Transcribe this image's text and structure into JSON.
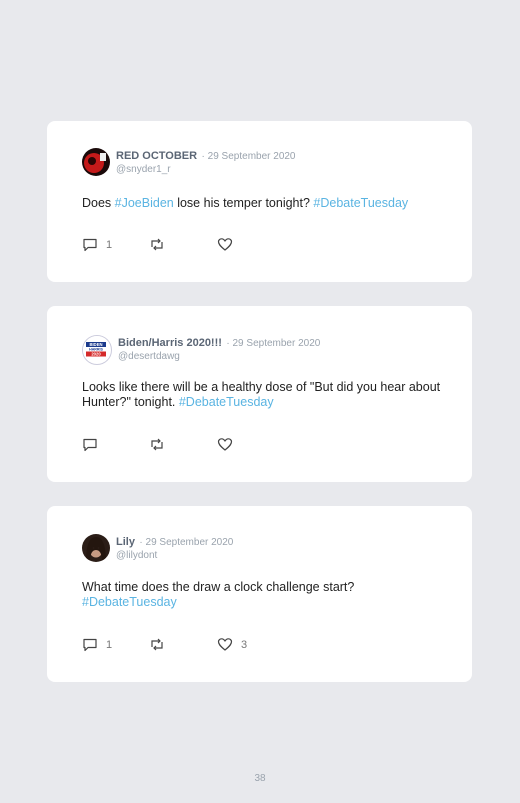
{
  "tweets": [
    {
      "name": "RED OCTOBER",
      "date": "· 29 September 2020",
      "handle": "@snyder1_r",
      "text_before": "Does ",
      "tag1": "#JoeBiden",
      "text_middle": " lose his temper tonight? ",
      "tag2": "#DebateTuesday",
      "replies": "1",
      "retweets": "",
      "likes": ""
    },
    {
      "name": "Biden/Harris 2020!!!",
      "date": "· 29 September 2020",
      "handle": "@desertdawg",
      "text_before": "Looks like there will be a healthy dose of \"But did you hear about Hunter?\" tonight. ",
      "tag1": "#DebateTuesday",
      "replies": "",
      "retweets": "",
      "likes": "",
      "avatar_text": "BIDEN HARRIS 2020"
    },
    {
      "name": "Lily",
      "date": "· 29 September 2020",
      "handle": "@lilydont",
      "text_before": "What time does the draw a clock challenge start?",
      "tag1": "#DebateTuesday",
      "replies": "1",
      "retweets": "",
      "likes": "3"
    }
  ],
  "page_number": "38",
  "icons": {
    "reply": "reply-icon",
    "retweet": "retweet-icon",
    "like": "heart-icon"
  },
  "colors": {
    "hashtag": "#5ab4e2",
    "background": "#e8e9ed",
    "card": "#ffffff"
  }
}
